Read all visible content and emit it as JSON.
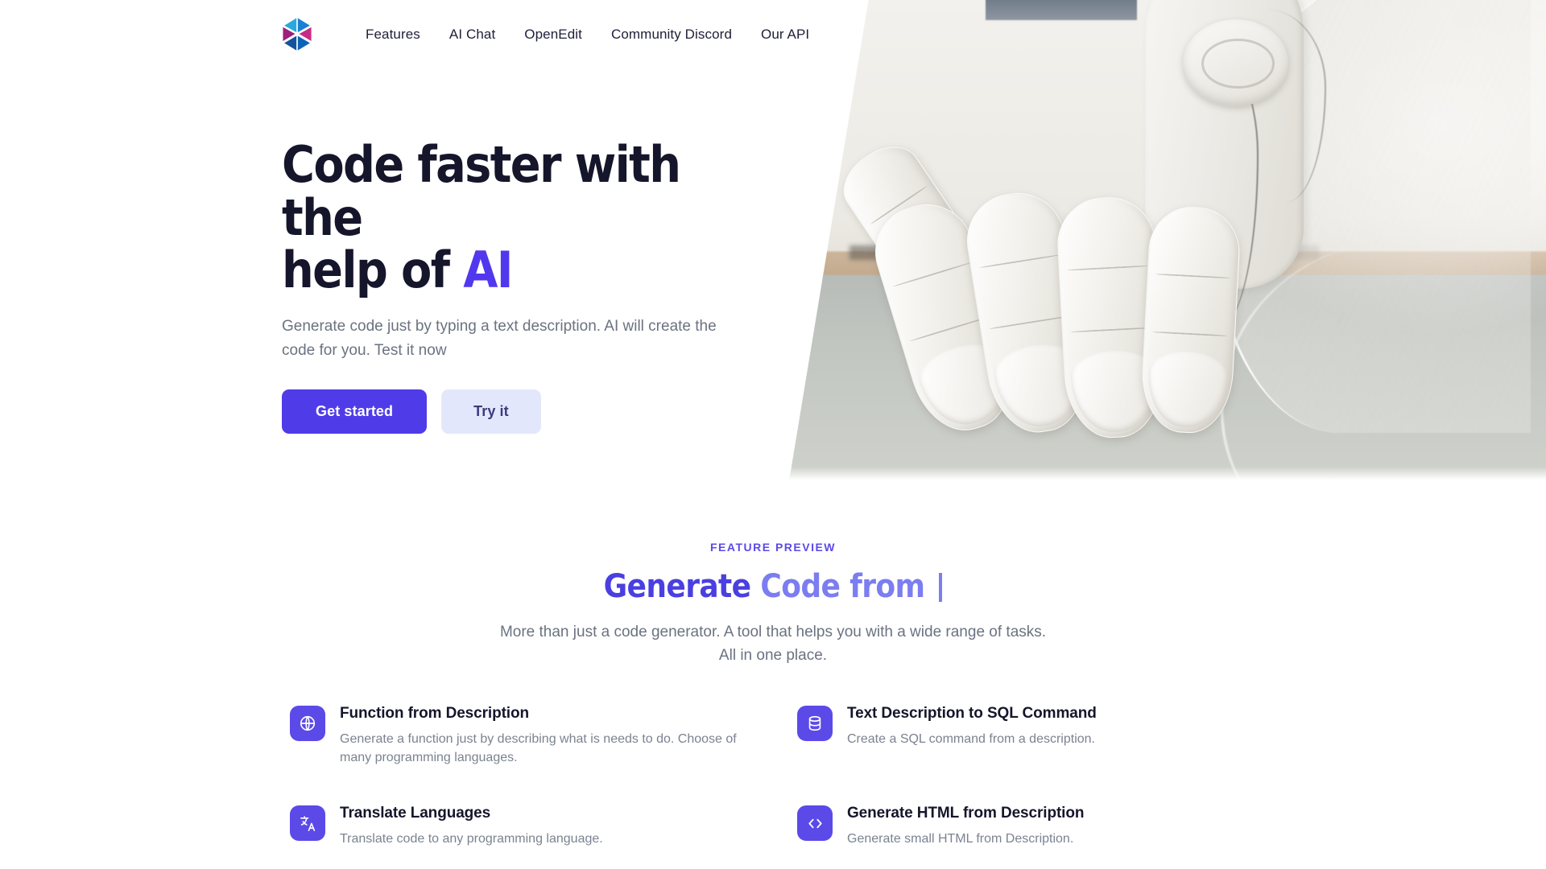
{
  "brand": {
    "logo_icon": "hexagon-star-logo",
    "accent_color": "#4f3ce8",
    "accent_light_color": "#7b7df0",
    "accent_soft_bg": "#e3e7fb"
  },
  "nav": {
    "items": [
      {
        "label": "Features",
        "name": "nav-link-features"
      },
      {
        "label": "AI Chat",
        "name": "nav-link-ai-chat"
      },
      {
        "label": "OpenEdit",
        "name": "nav-link-openedit"
      },
      {
        "label": "Community Discord",
        "name": "nav-link-community-discord"
      },
      {
        "label": "Our API",
        "name": "nav-link-our-api"
      }
    ]
  },
  "hero": {
    "title_line1": "Code faster with the",
    "title_line2_prefix": "help of ",
    "title_accent": "AI",
    "subtitle": "Generate code just by typing a text description. AI will create the code for you. Test it now",
    "primary_button": "Get started",
    "secondary_button": "Try it",
    "image_alt": "white humanoid robot hand resting on a wooden ledge"
  },
  "features": {
    "eyebrow": "FEATURE PREVIEW",
    "title_static": "Generate ",
    "title_typed": "Code from ",
    "subtitle": "More than just a code generator. A tool that helps you with a wide range of tasks. All in one place.",
    "cards": [
      {
        "icon": "globe-icon",
        "title": "Function from Description",
        "desc": "Generate a function just by describing what is needs to do. Choose of many programming languages."
      },
      {
        "icon": "database-icon",
        "title": "Text Description to SQL Command",
        "desc": "Create a SQL command from a description."
      },
      {
        "icon": "translate-icon",
        "title": "Translate Languages",
        "desc": "Translate code to any programming language."
      },
      {
        "icon": "code-brackets-icon",
        "title": "Generate HTML from Description",
        "desc": "Generate small HTML from Description."
      }
    ]
  }
}
